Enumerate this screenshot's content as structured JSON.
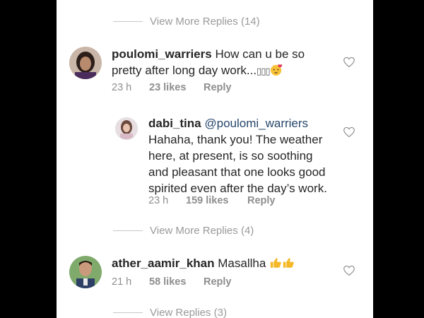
{
  "thread": {
    "view_more_top": "View More Replies (14)",
    "view_more_mid": "View More Replies (4)",
    "view_replies_bottom": "View Replies (3)"
  },
  "comments": [
    {
      "username": "poulomi_warriers",
      "text_line1": "How can u be so",
      "text_line2": "pretty after long day work...",
      "text_suffix_glyphs": "▯▯▯",
      "emoji": "blushing-kiss-emoji",
      "time": "23 h",
      "likes": "23 likes",
      "reply": "Reply"
    },
    {
      "username": "dabi_tina",
      "mention": "@poulomi_warriers",
      "lines": [
        "Hahaha, thank you! The weather",
        "here, at present, is so soothing",
        "and pleasant that one looks good",
        "spirited even after the day’s work."
      ],
      "time": "23 h",
      "likes": "159 likes",
      "reply": "Reply"
    },
    {
      "username": "ather_aamir_khan",
      "text": "Masallha",
      "emoji": "thumbs-up-emoji",
      "time": "21 h",
      "likes": "58 likes",
      "reply": "Reply"
    }
  ],
  "colors": {
    "text": "#262626",
    "muted": "#8e8e8e",
    "mention": "#27476b",
    "background": "#ffffff",
    "letterbox": "#000000"
  }
}
